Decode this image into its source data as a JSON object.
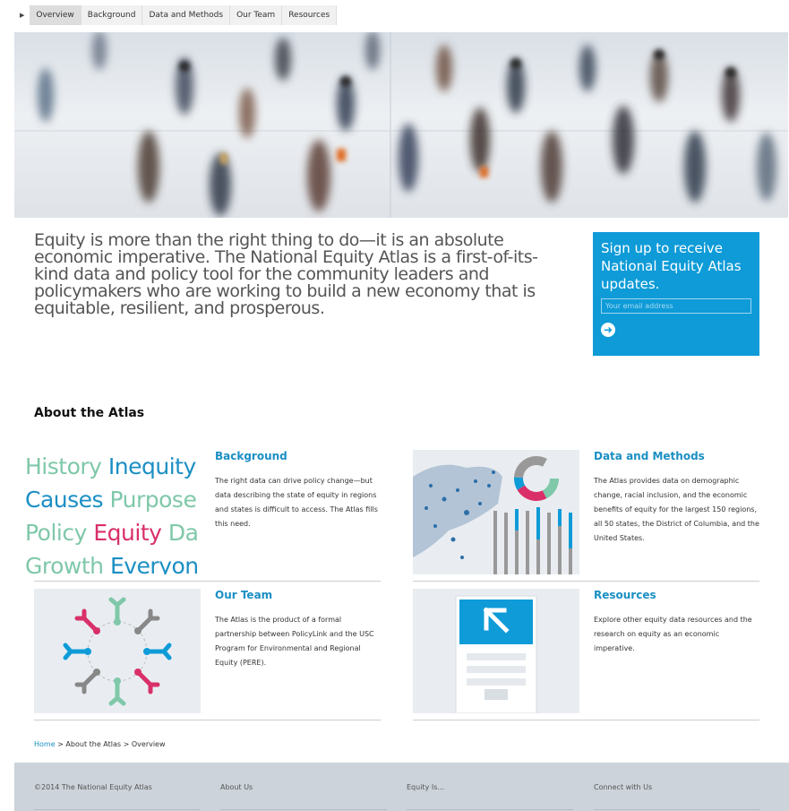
{
  "nav": {
    "tabs": [
      "Overview",
      "Background",
      "Data and Methods",
      "Our Team",
      "Resources"
    ]
  },
  "intro": "Equity is more than the right thing to do—it is an absolute economic imperative. The National Equity Atlas is a first-of-its-kind data and policy tool for the community leaders and policymakers who are working to build a new economy that is equitable, resilient, and prosperous.",
  "signup": {
    "title": "Sign up to receive National Equity Atlas updates.",
    "placeholder": "Your email address"
  },
  "about": {
    "heading": "About the Atlas",
    "cards": [
      {
        "title": "Background",
        "desc": "The right data can drive policy change—but data describing the state of equity in regions and states is difficult to access. The Atlas fills this need."
      },
      {
        "title": "Data and Methods",
        "desc": "The Atlas provides data on demographic change, racial inclusion, and the economic benefits of equity for the largest 150 regions, all 50 states, the District of Columbia, and the United States."
      },
      {
        "title": "Our Team",
        "desc": "The Atlas is the product of a formal partnership between PolicyLink and the USC Program for Environmental and Regional Equity (PERE)."
      },
      {
        "title": "Resources",
        "desc": "Explore other equity data resources and the research on equity as an economic imperative."
      }
    ],
    "word_cloud": [
      {
        "text": "History ",
        "color": "#7fc8a9"
      },
      {
        "text": "Inequity",
        "color": "#1b8fc4"
      },
      {
        "text": "Causes ",
        "color": "#1b8fc4"
      },
      {
        "text": "Purpose",
        "color": "#7fc8a9"
      },
      {
        "text": "Policy ",
        "color": "#7fc8a9"
      },
      {
        "text": "Equity ",
        "color": "#d9306a"
      },
      {
        "text": "Da",
        "color": "#7fc8a9"
      },
      {
        "text": "Growth ",
        "color": "#7fc8a9"
      },
      {
        "text": "Everyon",
        "color": "#1b8fc4"
      }
    ]
  },
  "breadcrumb": {
    "home": "Home",
    "sep": " > ",
    "about": "About the Atlas",
    "current": "Overview"
  },
  "footer": {
    "copyright": "©2014 The National Equity Atlas",
    "cols": [
      "About Us",
      "Equity Is...",
      "Connect with Us"
    ]
  },
  "colors": {
    "accent": "#0e9bd8",
    "link": "#1b8fc4",
    "pink": "#d9306a",
    "green": "#7fc8a9"
  }
}
